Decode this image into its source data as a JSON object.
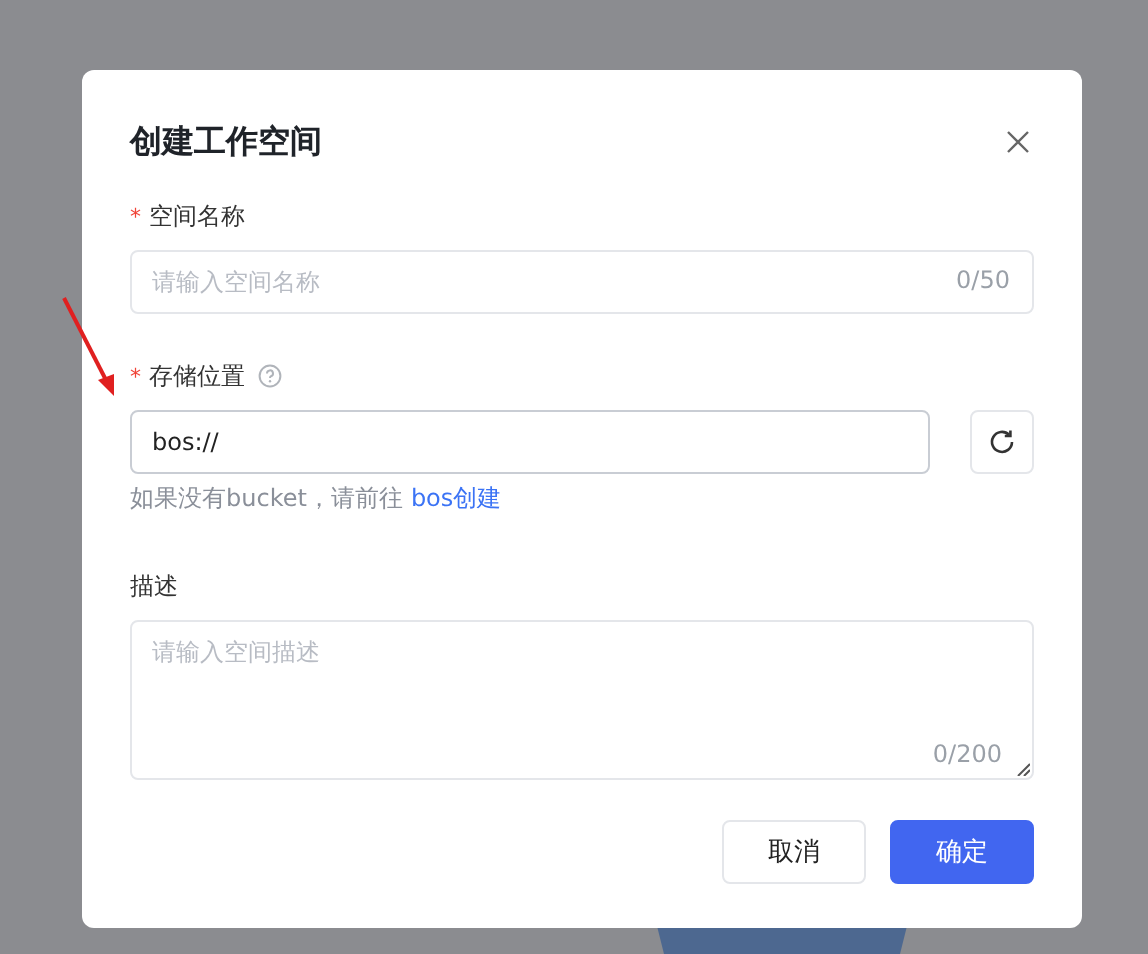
{
  "dialog": {
    "title": "创建工作空间",
    "fields": [
      {
        "kind": "input",
        "required_mark": "*",
        "label": "空间名称",
        "placeholder": "请输入空间名称",
        "counter": "0/50"
      },
      {
        "kind": "location",
        "required_mark": "*",
        "label": "存储位置",
        "help": true,
        "value": "bos://",
        "hint": "如果没有bucket，请前往",
        "link": "bos创建"
      },
      {
        "kind": "textarea",
        "label": "描述",
        "placeholder": "请输入空间描述",
        "counter": "0/200"
      }
    ],
    "buttons": [
      {
        "label": "取消",
        "kind": "default"
      },
      {
        "label": "确定",
        "kind": "primary"
      }
    ]
  }
}
